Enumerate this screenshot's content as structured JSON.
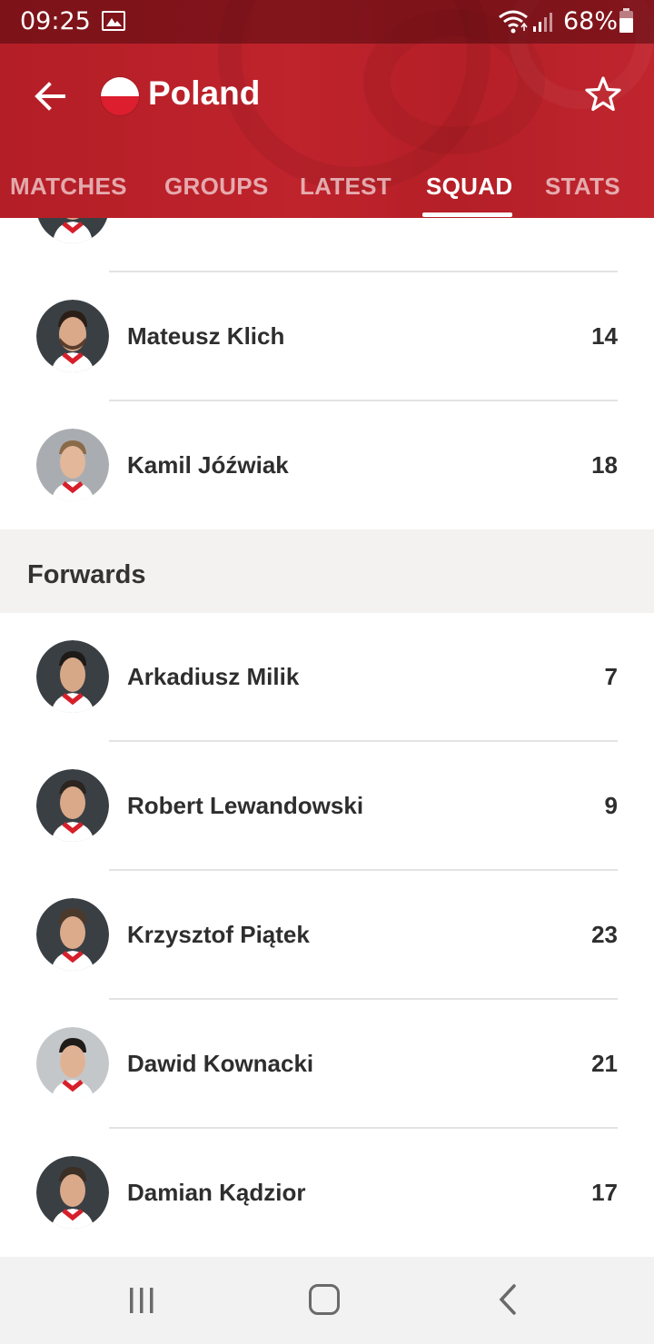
{
  "status_bar": {
    "time": "09:25",
    "battery_percent": "68%",
    "battery_level": 0.68,
    "icons": [
      "image-icon",
      "wifi-icon",
      "signal-icon",
      "battery-icon"
    ]
  },
  "app_bar": {
    "title": "Poland",
    "flag_colors": [
      "#ffffff",
      "#dc1e2e"
    ],
    "back_icon": "arrow-left-icon",
    "favorite_icon": "star-outline-icon"
  },
  "tabs": [
    {
      "label": "MATCHES",
      "active": false
    },
    {
      "label": "GROUPS",
      "active": false
    },
    {
      "label": "LATEST",
      "active": false
    },
    {
      "label": "SQUAD",
      "active": true
    },
    {
      "label": "STATS",
      "active": false
    }
  ],
  "squad": {
    "midfielders_visible": [
      {
        "name": "Mateusz Klich",
        "number": "14"
      },
      {
        "name": "Kamil Jóźwiak",
        "number": "18"
      }
    ],
    "forwards_section_title": "Forwards",
    "forwards": [
      {
        "name": "Arkadiusz Milik",
        "number": "7"
      },
      {
        "name": "Robert Lewandowski",
        "number": "9"
      },
      {
        "name": "Krzysztof Piątek",
        "number": "23"
      },
      {
        "name": "Dawid Kownacki",
        "number": "21"
      },
      {
        "name": "Damian Kądzior",
        "number": "17"
      }
    ]
  },
  "colors": {
    "header_red": "#bf232c",
    "section_bg": "#f3f2f1",
    "text_dark": "#2e2e2e"
  },
  "nav_bar": {
    "icons": [
      "recent-apps-icon",
      "home-icon",
      "back-icon"
    ]
  }
}
